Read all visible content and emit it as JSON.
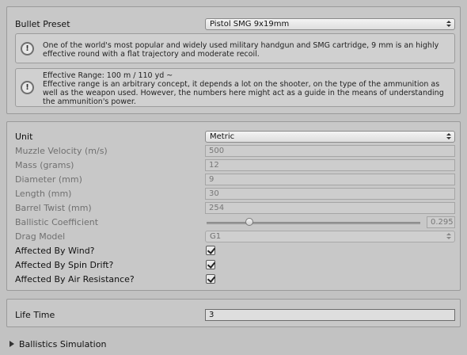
{
  "preset": {
    "label": "Bullet Preset",
    "value": "Pistol SMG 9x19mm",
    "info": "One of the world's most popular and widely used military handgun and SMG cartridge, 9 mm is an highly effective round with a flat trajectory and moderate recoil.",
    "range_title": "Effective Range: 100 m / 110 yd ~",
    "range_text": "Effective range is an arbitrary concept, it depends a lot on the shooter, on the type of the ammunition as well as the weapon used. However, the numbers here might act as a guide in the means of understanding the ammunition's power."
  },
  "properties": {
    "unit": {
      "label": "Unit",
      "value": "Metric"
    },
    "muzzle_velocity": {
      "label": "Muzzle Velocity (m/s)",
      "value": "500"
    },
    "mass": {
      "label": "Mass (grams)",
      "value": "12"
    },
    "diameter": {
      "label": "Diameter (mm)",
      "value": "9"
    },
    "length": {
      "label": "Length (mm)",
      "value": "30"
    },
    "barrel_twist": {
      "label": "Barrel Twist (mm)",
      "value": "254"
    },
    "ballistic_coefficient": {
      "label": "Ballistic Coefficient",
      "value": "0.295",
      "slider_fraction": 0.2
    },
    "drag_model": {
      "label": "Drag Model",
      "value": "G1"
    },
    "affected_by_wind": {
      "label": "Affected By Wind?",
      "checked": true
    },
    "affected_by_spin_drift": {
      "label": "Affected By Spin Drift?",
      "checked": true
    },
    "affected_by_air_resistance": {
      "label": "Affected By Air Resistance?",
      "checked": true
    }
  },
  "lifetime": {
    "label": "Life Time",
    "value": "3"
  },
  "simulation": {
    "label": "Ballistics Simulation",
    "expanded": false
  }
}
